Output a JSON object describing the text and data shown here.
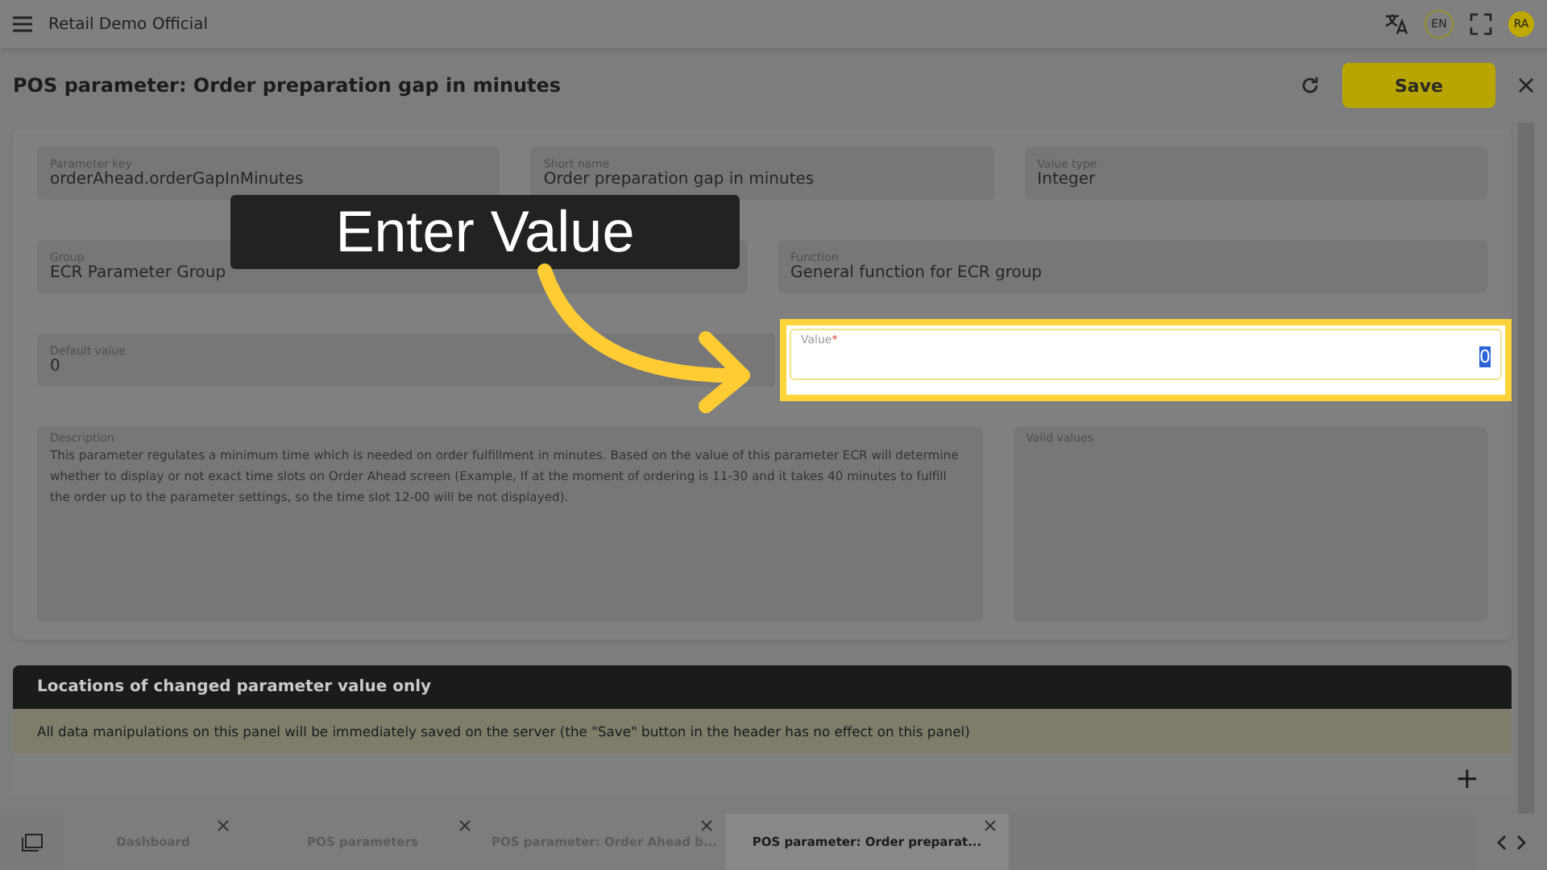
{
  "app_bar": {
    "title": "Retail Demo Official",
    "language": "EN",
    "avatar": "RA"
  },
  "header": {
    "title": "POS parameter: Order preparation gap in minutes",
    "save_label": "Save"
  },
  "form": {
    "parameter_key": {
      "label": "Parameter key",
      "value": "orderAhead.orderGapInMinutes"
    },
    "short_name": {
      "label": "Short name",
      "value": "Order preparation gap in minutes"
    },
    "value_type": {
      "label": "Value type",
      "value": "Integer"
    },
    "group": {
      "label": "Group",
      "value": "ECR Parameter Group"
    },
    "function": {
      "label": "Function",
      "value": "General function for ECR group"
    },
    "default_value": {
      "label": "Default value",
      "value": "0"
    },
    "value": {
      "label": "Value",
      "required_mark": "*",
      "value": "0",
      "text_selected": true
    },
    "description": {
      "label": "Description",
      "value": "This parameter regulates a minimum time which is needed on order fulfillment in minutes. Based on the value of this parameter ECR will determine whether to display or not exact time slots on Order Ahead screen (Example, If at the moment of ordering is 11-30 and it takes 40 minutes to fulfill the order up to the parameter settings, so the time slot 12-00 will be not displayed)."
    },
    "valid_values": {
      "label": "Valid values"
    }
  },
  "locations_panel": {
    "title": "Locations of changed parameter value only",
    "notice": "All data manipulations on this panel will be immediately saved on the server (the \"Save\" button in the header has no effect on this panel)",
    "add_label": "+"
  },
  "tabs": [
    {
      "label": "Dashboard",
      "selected": false
    },
    {
      "label": "POS parameters",
      "selected": false
    },
    {
      "label": "POS parameter: Order Ahead b...",
      "selected": false
    },
    {
      "label": "POS parameter: Order preparat...",
      "selected": true
    }
  ],
  "callout": {
    "text": "Enter Value"
  }
}
